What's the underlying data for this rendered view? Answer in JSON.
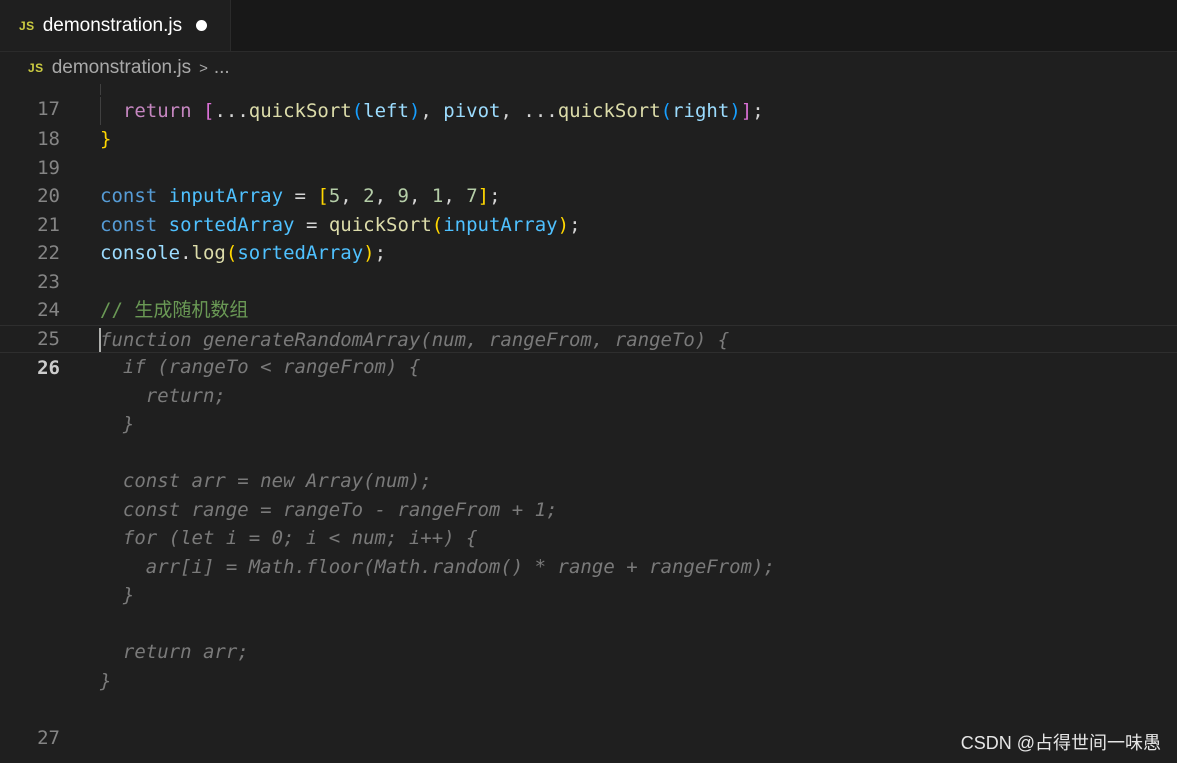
{
  "tab": {
    "badge": "JS",
    "title": "demonstration.js"
  },
  "breadcrumb": {
    "badge": "JS",
    "file": "demonstration.js",
    "separator": ">",
    "rest": "..."
  },
  "line_numbers": {
    "l17": "17",
    "l18": "18",
    "l19": "19",
    "l20": "20",
    "l21": "21",
    "l22": "22",
    "l23": "23",
    "l24": "24",
    "l25": "25",
    "l26": "26",
    "l27": "27"
  },
  "code": {
    "l18": {
      "kw": "return",
      "open": "[",
      "spread1": "...",
      "fn1": "quickSort",
      "po1": "(",
      "arg1": "left",
      "pc1": ")",
      "sep1": ", ",
      "arg2": "pivot",
      "sep2": ", ",
      "spread2": "...",
      "fn2": "quickSort",
      "po2": "(",
      "arg3": "right",
      "pc2": ")",
      "close": "]",
      "semi": ";"
    },
    "l19": {
      "brace": "}"
    },
    "l21": {
      "kw": "const",
      "name": "inputArray",
      "eq": " = ",
      "open": "[",
      "n1": "5",
      "c1": ", ",
      "n2": "2",
      "c2": ", ",
      "n3": "9",
      "c3": ", ",
      "n4": "1",
      "c4": ", ",
      "n5": "7",
      "close": "]",
      "semi": ";"
    },
    "l22": {
      "kw": "const",
      "name": "sortedArray",
      "eq": " = ",
      "fn": "quickSort",
      "po": "(",
      "arg": "inputArray",
      "pc": ")",
      "semi": ";"
    },
    "l23": {
      "obj": "console",
      "dot": ".",
      "fn": "log",
      "po": "(",
      "arg": "sortedArray",
      "pc": ")",
      "semi": ";"
    },
    "l25": {
      "comment": "// 生成随机数组"
    }
  },
  "suggestion": [
    "function generateRandomArray(num, rangeFrom, rangeTo) {",
    "  if (rangeTo < rangeFrom) {",
    "    return;",
    "  }",
    "",
    "  const arr = new Array(num);",
    "  const range = rangeTo - rangeFrom + 1;",
    "  for (let i = 0; i < num; i++) {",
    "    arr[i] = Math.floor(Math.random() * range + rangeFrom);",
    "  }",
    "",
    "  return arr;",
    "}"
  ],
  "watermark": "CSDN @占得世间一味愚",
  "colors": {
    "keyword": "#569cd6",
    "control": "#c586c0",
    "function": "#dcdcaa",
    "variable": "#9cdcfe",
    "number": "#b5cea8",
    "comment": "#6a9955",
    "ghost_text": "#7a7a7a",
    "background": "#1f1f1f"
  }
}
